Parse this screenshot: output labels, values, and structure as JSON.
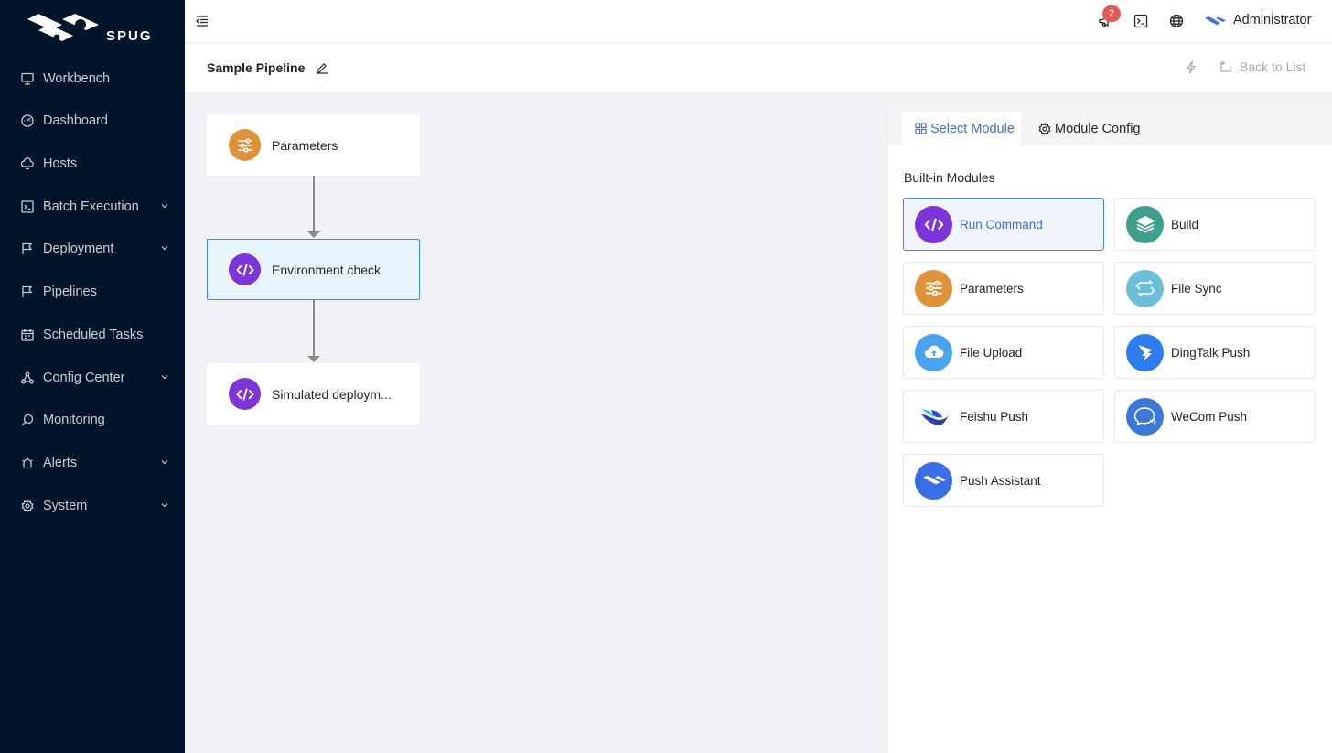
{
  "app": {
    "logo_text": "SPUG",
    "user_name": "Administrator",
    "notification_count": "2"
  },
  "sidebar": {
    "items": [
      {
        "label": "Workbench",
        "icon": "monitor-icon",
        "has_submenu": false
      },
      {
        "label": "Dashboard",
        "icon": "dashboard-icon",
        "has_submenu": false
      },
      {
        "label": "Hosts",
        "icon": "cloud-server-icon",
        "has_submenu": false
      },
      {
        "label": "Batch Execution",
        "icon": "code-terminal-icon",
        "has_submenu": true
      },
      {
        "label": "Deployment",
        "icon": "flag-icon",
        "has_submenu": true
      },
      {
        "label": "Pipelines",
        "icon": "flag-icon",
        "has_submenu": false
      },
      {
        "label": "Scheduled Tasks",
        "icon": "calendar-icon",
        "has_submenu": false
      },
      {
        "label": "Config Center",
        "icon": "deployment-unit-icon",
        "has_submenu": true
      },
      {
        "label": "Monitoring",
        "icon": "search-icon",
        "has_submenu": false
      },
      {
        "label": "Alerts",
        "icon": "alert-icon",
        "has_submenu": true
      },
      {
        "label": "System",
        "icon": "setting-icon",
        "has_submenu": true
      }
    ]
  },
  "titlebar": {
    "title": "Sample Pipeline",
    "back_label": "Back to List"
  },
  "pipeline": {
    "nodes": [
      {
        "label": "Parameters",
        "icon": "sliders-icon",
        "color": "#e0923a",
        "active": false
      },
      {
        "label": "Environment check",
        "icon": "code-icon",
        "color": "#7b35d8",
        "active": true
      },
      {
        "label": "Simulated deploym...",
        "icon": "code-icon",
        "color": "#7b35d8",
        "active": false
      }
    ]
  },
  "panel": {
    "tabs": [
      {
        "label": "Select Module",
        "icon": "appstore-icon",
        "active": true
      },
      {
        "label": "Module Config",
        "icon": "setting-icon",
        "active": false
      }
    ],
    "section_label": "Built-in Modules",
    "modules": [
      {
        "label": "Run Command",
        "icon": "code-icon",
        "color": "#7b35d8",
        "selected": true
      },
      {
        "label": "Build",
        "icon": "layers-icon",
        "color": "#3f9e8c",
        "selected": false
      },
      {
        "label": "Parameters",
        "icon": "sliders-icon",
        "color": "#e0923a",
        "selected": false
      },
      {
        "label": "File Sync",
        "icon": "swap-icon",
        "color": "#6bbfd6",
        "selected": false
      },
      {
        "label": "File Upload",
        "icon": "cloud-upload-icon",
        "color": "#4aa3ef",
        "selected": false
      },
      {
        "label": "DingTalk Push",
        "icon": "dingtalk-icon",
        "color": "#2d7cf0",
        "selected": false
      },
      {
        "label": "Feishu Push",
        "icon": "feishu-icon",
        "color": "#ffffff",
        "selected": false
      },
      {
        "label": "WeCom Push",
        "icon": "wecom-icon",
        "color": "#3c78d8",
        "selected": false
      },
      {
        "label": "Push Assistant",
        "icon": "push-assistant-icon",
        "color": "#3a6de8",
        "selected": false
      }
    ]
  }
}
